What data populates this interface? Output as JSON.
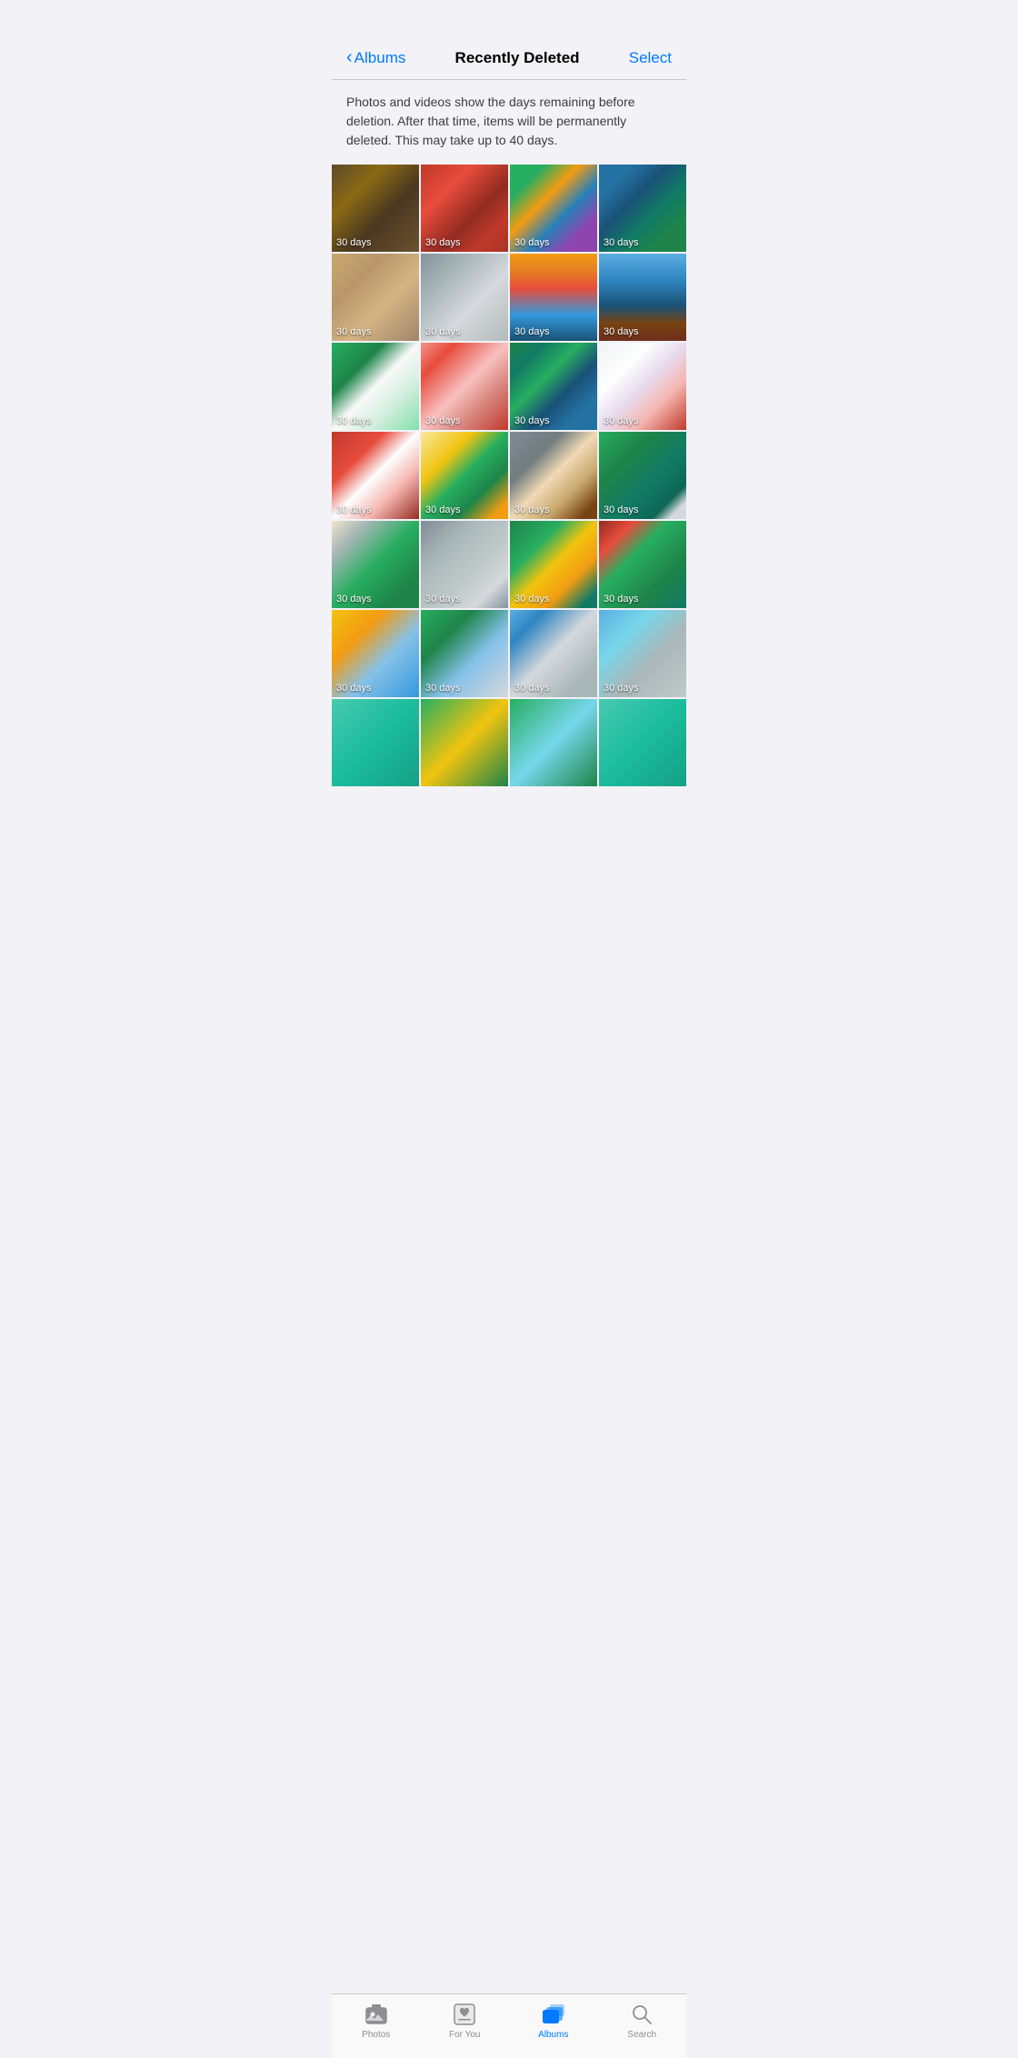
{
  "nav": {
    "back_label": "Albums",
    "title": "Recently Deleted",
    "select_label": "Select"
  },
  "info_text": "Photos and videos show the days remaining before deletion. After that time, items will be permanently deleted. This may take up to 40 days.",
  "days_label": "30 days",
  "photos": [
    {
      "id": 1,
      "style": "photo-leaf-autumn",
      "days": "30 days"
    },
    {
      "id": 2,
      "style": "photo-jump-red",
      "days": "30 days"
    },
    {
      "id": 3,
      "style": "photo-graffiti",
      "days": "30 days"
    },
    {
      "id": 4,
      "style": "photo-rusty-gear",
      "days": "30 days"
    },
    {
      "id": 5,
      "style": "photo-leaf-sand",
      "days": "30 days"
    },
    {
      "id": 6,
      "style": "photo-beach-run",
      "days": "30 days"
    },
    {
      "id": 7,
      "style": "photo-sunset-sky",
      "days": "30 days"
    },
    {
      "id": 8,
      "style": "photo-bare-trees",
      "days": "30 days"
    },
    {
      "id": 9,
      "style": "photo-tulips",
      "days": "30 days"
    },
    {
      "id": 10,
      "style": "photo-pink-flowers",
      "days": "30 days"
    },
    {
      "id": 11,
      "style": "photo-peacock",
      "days": "30 days"
    },
    {
      "id": 12,
      "style": "photo-petals",
      "days": "30 days"
    },
    {
      "id": 13,
      "style": "photo-red-peony",
      "days": "30 days"
    },
    {
      "id": 14,
      "style": "photo-yellow-flower",
      "days": "30 days"
    },
    {
      "id": 15,
      "style": "photo-coffee",
      "days": "30 days"
    },
    {
      "id": 16,
      "style": "photo-fern",
      "days": "30 days"
    },
    {
      "id": 17,
      "style": "photo-grass",
      "days": "30 days"
    },
    {
      "id": 18,
      "style": "photo-pebbles",
      "days": "30 days"
    },
    {
      "id": 19,
      "style": "photo-yellow-plant",
      "days": "30 days"
    },
    {
      "id": 20,
      "style": "photo-salad",
      "days": "30 days"
    },
    {
      "id": 21,
      "style": "photo-yellow-field",
      "days": "30 days"
    },
    {
      "id": 22,
      "style": "photo-green-meadow",
      "days": "30 days"
    },
    {
      "id": 23,
      "style": "photo-winding-river",
      "days": "30 days"
    },
    {
      "id": 24,
      "style": "photo-jumping",
      "days": "30 days"
    },
    {
      "id": 25,
      "style": "photo-partial1",
      "days": ""
    },
    {
      "id": 26,
      "style": "photo-partial2",
      "days": ""
    },
    {
      "id": 27,
      "style": "photo-partial3",
      "days": ""
    },
    {
      "id": 28,
      "style": "photo-partial1",
      "days": ""
    }
  ],
  "tabs": [
    {
      "id": "photos",
      "label": "Photos",
      "active": false
    },
    {
      "id": "for-you",
      "label": "For You",
      "active": false
    },
    {
      "id": "albums",
      "label": "Albums",
      "active": true
    },
    {
      "id": "search",
      "label": "Search",
      "active": false
    }
  ]
}
